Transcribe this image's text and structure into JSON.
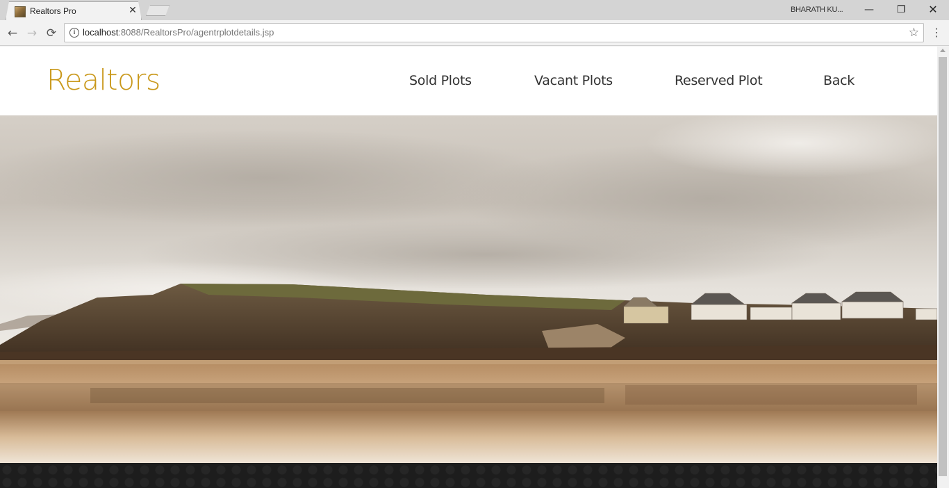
{
  "browser": {
    "tab_title": "Realtors Pro",
    "tab_close": "✕",
    "profile_name": "BHARATH KU...",
    "window_controls": {
      "minimize": "—",
      "maximize": "❐",
      "close": "✕"
    },
    "nav": {
      "back": "←",
      "forward": "→",
      "reload": "⟳"
    },
    "url_host": "localhost",
    "url_path": ":8088/RealtorsPro/agentrplotdetails.jsp",
    "info_icon": "i",
    "bookmark_icon": "☆",
    "menu_icon": "⋮"
  },
  "site": {
    "brand": "Realtors",
    "brand_color": "#c9981a",
    "nav": {
      "sold": "Sold Plots",
      "vacant": "Vacant Plots",
      "reserved": "Reserved Plot",
      "back": "Back"
    }
  },
  "hero": {
    "image": "coastal-cliff-beach-photo"
  }
}
